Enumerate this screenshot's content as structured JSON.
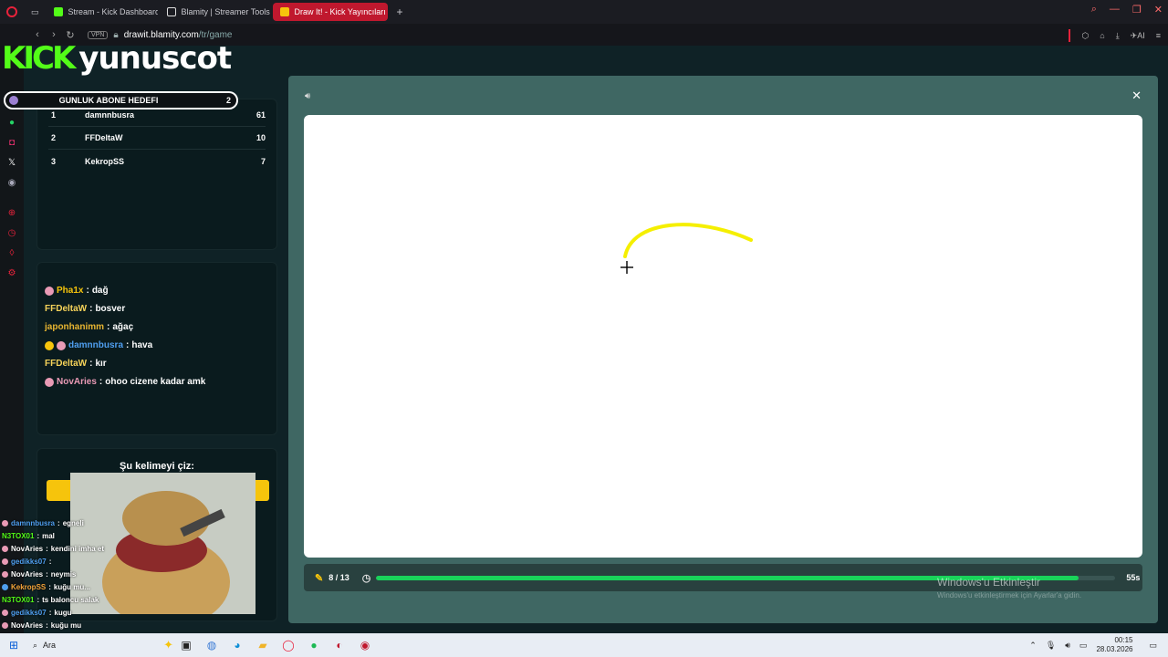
{
  "browser": {
    "tabs": [
      {
        "label": "Stream - Kick Dashboard",
        "color": "#53fc18",
        "active": false
      },
      {
        "label": "Blamity | Streamer Tools &",
        "color": "#dddddd",
        "active": false
      },
      {
        "label": "Draw It! - Kick Yayıncıları İçi",
        "color": "#f6c40c",
        "active": true
      }
    ],
    "new_tab": "+",
    "vpn": "VPN",
    "url_host": "drawit.blamity.com",
    "url_path": "/tr/game",
    "url_prefix": "",
    "ai_label": "AI"
  },
  "stream_overlay": {
    "brand_kick": "KICK",
    "brand_user": "yunuscot",
    "goal_label": "GUNLUK ABONE HEDEFI",
    "goal_count": "2"
  },
  "leaderboard": [
    {
      "rank": "1",
      "name": "damnnbusra",
      "score": "61"
    },
    {
      "rank": "2",
      "name": "FFDeltaW",
      "score": "10"
    },
    {
      "rank": "3",
      "name": "KekropSS",
      "score": "7"
    }
  ],
  "chat": [
    {
      "user": "Pha1x",
      "msg": "dağ",
      "color": "#f6c40c",
      "badges": [
        "#e99ab5"
      ]
    },
    {
      "user": "FFDeltaW",
      "msg": "bosver",
      "color": "#f6d35a",
      "badges": []
    },
    {
      "user": "japonhanimm",
      "msg": "ağaç",
      "color": "#e8b531",
      "badges": []
    },
    {
      "user": "damnnbusra",
      "msg": "hava",
      "color": "#4f9ff0",
      "badges": [
        "#f6c40c",
        "#e99ab5"
      ]
    },
    {
      "user": "FFDeltaW",
      "msg": "kır",
      "color": "#f6d35a",
      "badges": []
    },
    {
      "user": "NovAries",
      "msg": "ohoo cizene kadar amk",
      "color": "#e99ab5",
      "badges": [
        "#e99ab5"
      ]
    }
  ],
  "draw_prompt": "Şu kelimeyi çiz:",
  "game": {
    "round": "8 / 13",
    "time_left": "55s",
    "progress": 0.95,
    "stroke_color": "#f5ef00"
  },
  "overlay_chat": [
    {
      "user": "damnnbusra",
      "msg": "egneli",
      "color": "#4f9ff0"
    },
    {
      "user": "N3TOX01",
      "msg": "mal",
      "color": "#53fc18"
    },
    {
      "user": "NovAries",
      "msg": "kendini imha et",
      "color": "#ffffff"
    },
    {
      "user": "gedikks07",
      "msg": "",
      "color": "#4f9ff0"
    },
    {
      "user": "NovAries",
      "msg": "neymis",
      "color": "#ffffff"
    },
    {
      "user": "KekropSS",
      "msg": "kuğu mu...",
      "color": "#f6a53a"
    },
    {
      "user": "N3TOX01",
      "msg": "ts baloncu salak",
      "color": "#53fc18"
    },
    {
      "user": "gedikks07",
      "msg": "kugu",
      "color": "#4f9ff0"
    },
    {
      "user": "NovAries",
      "msg": "kuğu mu",
      "color": "#ffffff"
    }
  ],
  "watermark": {
    "title": "Windows'u Etkinleştir",
    "subtitle": "Windows'u etkinleştirmek için Ayarlar'a gidin."
  },
  "taskbar": {
    "search": "Ara",
    "time": "00:15",
    "date": "28.03.2026"
  }
}
